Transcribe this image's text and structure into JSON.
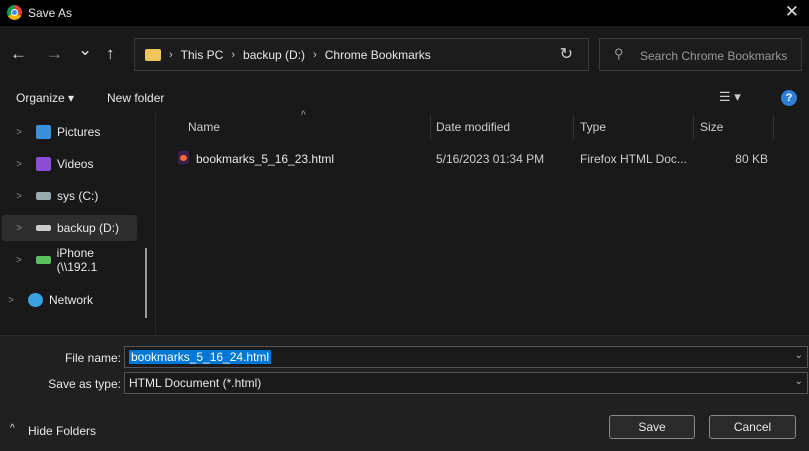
{
  "window": {
    "title": "Save As",
    "close": "✕"
  },
  "nav": {
    "back": "←",
    "forward": "→",
    "recent": "⌄",
    "up": "↑",
    "breadcrumb": [
      "This PC",
      "backup (D:)",
      "Chrome Bookmarks"
    ],
    "refresh": "↻",
    "search_placeholder": "Search Chrome Bookmarks"
  },
  "toolbar": {
    "organize": "Organize ▾",
    "new_folder": "New folder",
    "view": "☰ ▾",
    "help": "?"
  },
  "sidebar": {
    "items": [
      {
        "label": "Pictures",
        "color": "#3a8fd9"
      },
      {
        "label": "Videos",
        "color": "#8a4fd6"
      },
      {
        "label": "sys (C:)",
        "color": "#9aa"
      },
      {
        "label": "backup (D:)",
        "color": "#ccc"
      },
      {
        "label": "iPhone (\\\\192.1",
        "color": "#5cc060"
      },
      {
        "label": "Network",
        "color": "#3aa0e0"
      }
    ]
  },
  "columns": [
    "Name",
    "Date modified",
    "Type",
    "Size"
  ],
  "files": [
    {
      "name": "bookmarks_5_16_23.html",
      "date": "5/16/2023 01:34 PM",
      "type": "Firefox HTML Doc...",
      "size": "80 KB"
    }
  ],
  "form": {
    "file_name_label": "File name:",
    "file_name": "bookmarks_5_16_24.html",
    "type_label": "Save as type:",
    "type": "HTML Document (*.html)"
  },
  "footer": {
    "hide_folders": "Hide Folders",
    "save": "Save",
    "cancel": "Cancel"
  }
}
